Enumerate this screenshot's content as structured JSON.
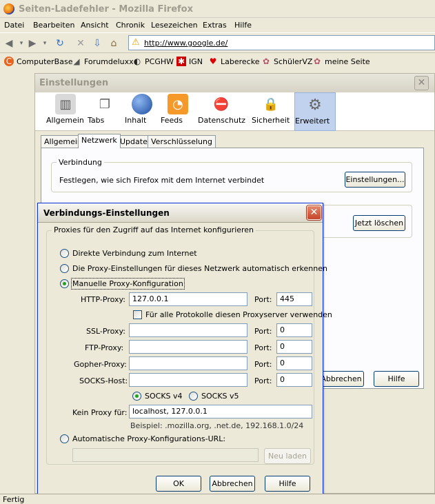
{
  "window": {
    "title": "Seiten-Ladefehler - Mozilla Firefox"
  },
  "menu": [
    "Datei",
    "Bearbeiten",
    "Ansicht",
    "Chronik",
    "Lesezeichen",
    "Extras",
    "Hilfe"
  ],
  "urlbar": {
    "value": "http://www.google.de/"
  },
  "bookmarks": [
    {
      "label": "ComputerBase",
      "icon": "cb-icon"
    },
    {
      "label": "Forumdeluxx",
      "icon": "fdx-icon"
    },
    {
      "label": "PCGHW",
      "icon": "pcghw-icon"
    },
    {
      "label": "IGN",
      "icon": "ign-icon"
    },
    {
      "label": "Laberecke",
      "icon": "heart-icon"
    },
    {
      "label": "SchülerVZ",
      "icon": "gear-icon"
    },
    {
      "label": "meine Seite",
      "icon": "gear-icon"
    }
  ],
  "status": "Fertig",
  "prefs": {
    "title": "Einstellungen",
    "categories": [
      "Allgemein",
      "Tabs",
      "Inhalt",
      "Feeds",
      "Datenschutz",
      "Sicherheit",
      "Erweitert"
    ],
    "tabs": [
      "Allgemein",
      "Netzwerk",
      "Update",
      "Verschlüsselung"
    ],
    "verbindung": {
      "legend": "Verbindung",
      "text": "Festlegen, wie sich Firefox mit dem Internet verbindet",
      "button": "Einstellungen..."
    },
    "cache_button": "Jetzt löschen",
    "cancel": "Abbrechen",
    "help": "Hilfe"
  },
  "conn": {
    "title": "Verbindungs-Einstellungen",
    "legend": "Proxies für den Zugriff auf das Internet konfigurieren",
    "opt_direct": "Direkte Verbindung zum Internet",
    "opt_auto": "Die Proxy-Einstellungen für dieses Netzwerk automatisch erkennen",
    "opt_manual": "Manuelle Proxy-Konfiguration",
    "http_label": "HTTP-Proxy:",
    "http_value": "127.0.0.1",
    "port_label": "Port:",
    "http_port": "445",
    "all_protocols": "Für alle Protokolle diesen Proxyserver verwenden",
    "ssl_label": "SSL-Proxy:",
    "ssl_port": "0",
    "ftp_label": "FTP-Proxy:",
    "ftp_port": "0",
    "gopher_label": "Gopher-Proxy:",
    "gopher_port": "0",
    "socks_label": "SOCKS-Host:",
    "socks_port": "0",
    "socks_v4": "SOCKS v4",
    "socks_v5": "SOCKS v5",
    "noproxy_label": "Kein Proxy für:",
    "noproxy_value": "localhost, 127.0.0.1",
    "example": "Beispiel: .mozilla.org, .net.de, 192.168.1.0/24",
    "opt_autourl": "Automatische Proxy-Konfigurations-URL:",
    "autourl_value": "",
    "reload": "Neu laden",
    "ok": "OK",
    "cancel": "Abbrechen",
    "help": "Hilfe"
  }
}
